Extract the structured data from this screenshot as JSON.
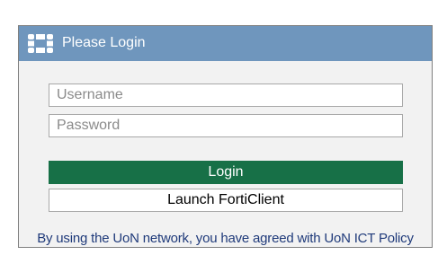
{
  "header": {
    "title": "Please Login",
    "icon": "fortinet-logo-icon",
    "background_color": "#6f96bd"
  },
  "form": {
    "username_placeholder": "Username",
    "username_value": "",
    "password_placeholder": "Password",
    "password_value": ""
  },
  "buttons": {
    "login_label": "Login",
    "login_color": "#177047",
    "forticlient_label": "Launch FortiClient"
  },
  "footer": {
    "policy_text": "By using the UoN network, you have agreed with UoN ICT Policy",
    "policy_color": "#1f3a7a"
  }
}
